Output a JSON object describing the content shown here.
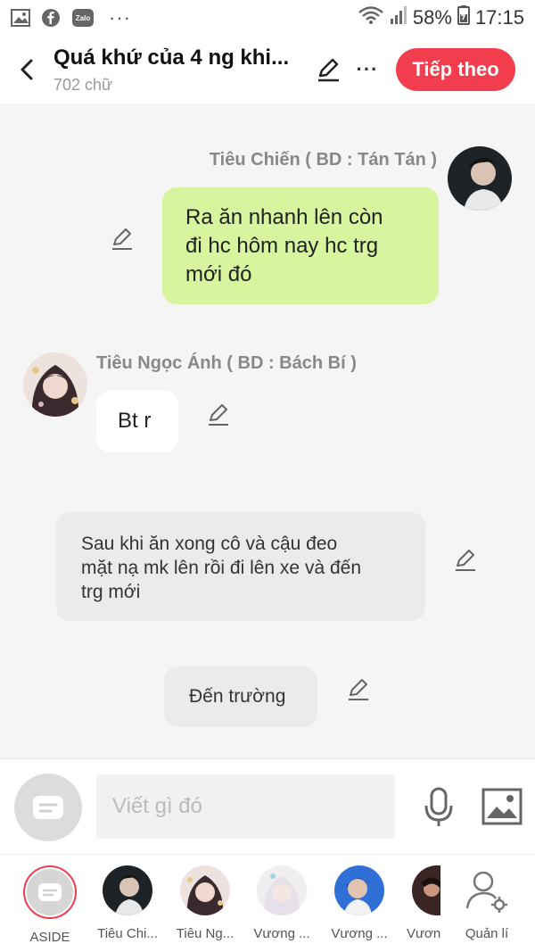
{
  "status_bar": {
    "app_icons": [
      "gallery-icon",
      "facebook-icon",
      "zalo-icon"
    ],
    "zalo_label": "Zalo",
    "more": "···",
    "battery": "58%",
    "time": "17:15"
  },
  "header": {
    "title": "Quá khứ của 4 ng khi...",
    "subtitle": "702 chữ",
    "next_label": "Tiếp theo",
    "more": "···"
  },
  "messages": [
    {
      "type": "dialogue",
      "side": "right",
      "speaker": "Tiêu Chiến ( BD : Tán Tán )",
      "lines": [
        "Ra ăn nhanh lên còn",
        "đi hc hôm nay hc trg",
        "mới đó"
      ]
    },
    {
      "type": "dialogue",
      "side": "left",
      "speaker": "Tiêu Ngọc Ánh ( BD : Bách Bí )",
      "lines": [
        "Bt r"
      ]
    },
    {
      "type": "aside",
      "lines": [
        "Sau khi ăn xong cô và cậu đeo",
        "mặt nạ mk lên rồi đi lên xe và đến",
        "trg mới"
      ]
    },
    {
      "type": "aside",
      "lines": [
        "Đến trường"
      ]
    }
  ],
  "input": {
    "placeholder": "Viết gì đó"
  },
  "characters": [
    {
      "label": "ASIDE"
    },
    {
      "label": "Tiêu Chi..."
    },
    {
      "label": "Tiêu Ng..."
    },
    {
      "label": "Vương ..."
    },
    {
      "label": "Vương ..."
    },
    {
      "label": "Vươn"
    },
    {
      "label": "Quản lí"
    }
  ],
  "colors": {
    "accent": "#f23d4f",
    "bubble_green": "#d7f49f",
    "bubble_gray": "#ebebeb"
  }
}
